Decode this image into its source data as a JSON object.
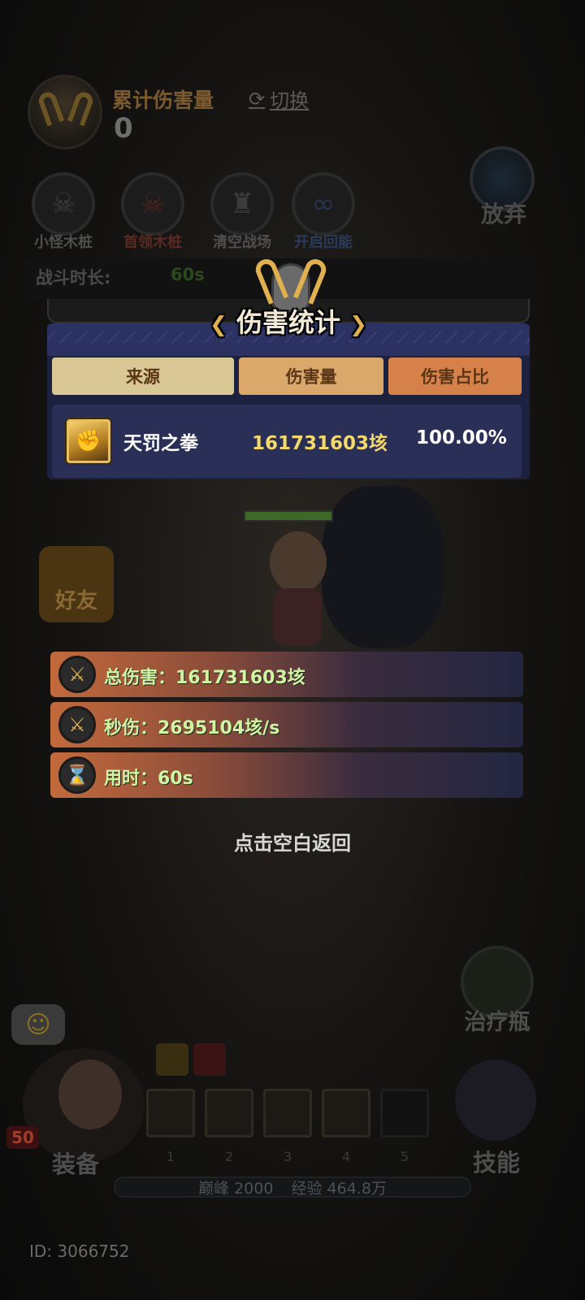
{
  "top": {
    "damage_title": "累计伤害量",
    "damage_value": "0",
    "switch_label": "切换"
  },
  "tools": [
    {
      "label": "小怪木桩",
      "color": "#4e4e4e"
    },
    {
      "label": "首领木桩",
      "color": "#5a2a22"
    },
    {
      "label": "清空战场",
      "color": "#4e4e4e"
    },
    {
      "label": "开启回能",
      "color": "#2a3a5a"
    }
  ],
  "abandon_label": "放弃",
  "battle": {
    "duration_label": "战斗时长:",
    "duration_value": "60s"
  },
  "stats_panel": {
    "title": "伤害统计",
    "columns": [
      "来源",
      "伤害量",
      "伤害占比"
    ],
    "rows": [
      {
        "source": "天罚之拳",
        "damage": "161731603垓",
        "share": "100.00%"
      }
    ]
  },
  "friend_label": "好友",
  "summary": {
    "total": "总伤害：161731603垓",
    "dps": "秒伤：2695104垓/s",
    "time": "用时：60s"
  },
  "back_hint": "点击空白返回",
  "potion_label": "治疗瓶",
  "equip_label": "装备",
  "skill_label": "技能",
  "level": "50",
  "slot_numbers": [
    "1",
    "2",
    "3",
    "4",
    "5"
  ],
  "peak": "巅峰 2000",
  "exp": "经验 464.8万",
  "player_id": "ID: 3066752",
  "colors": {
    "panel_bg": "#1c2140",
    "row_bg": "#2a2f58",
    "gold": "#e0b14e",
    "damage_yellow": "#f5d96a",
    "summary_text": "#cdf5a2"
  }
}
